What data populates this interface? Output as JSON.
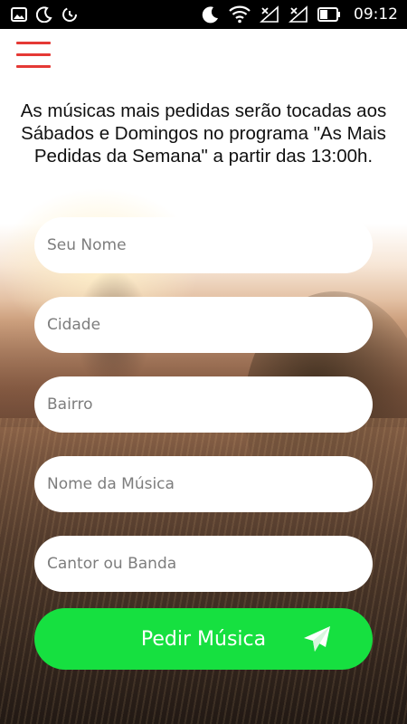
{
  "status_bar": {
    "time": "09:12",
    "left_icons": [
      "gallery-icon",
      "moon-icon",
      "data-saver-icon"
    ],
    "right_icons": [
      "moon-icon",
      "wifi-icon",
      "signal-1-icon",
      "signal-2-icon",
      "battery-icon"
    ]
  },
  "header": {
    "menu_icon": "hamburger-menu-icon",
    "menu_color": "#e53935"
  },
  "intro": {
    "text": "As músicas mais pedidas serão tocadas aos Sábados e Domingos no programa \"As Mais Pedidas da Semana\" a partir das 13:00h."
  },
  "form": {
    "fields": [
      {
        "placeholder": "Seu Nome",
        "value": ""
      },
      {
        "placeholder": "Cidade",
        "value": ""
      },
      {
        "placeholder": "Bairro",
        "value": ""
      },
      {
        "placeholder": "Nome da Música",
        "value": ""
      },
      {
        "placeholder": "Cantor ou Banda",
        "value": ""
      }
    ],
    "submit_label": "Pedir Música",
    "submit_icon": "paper-plane-icon",
    "submit_color": "#16e040"
  }
}
